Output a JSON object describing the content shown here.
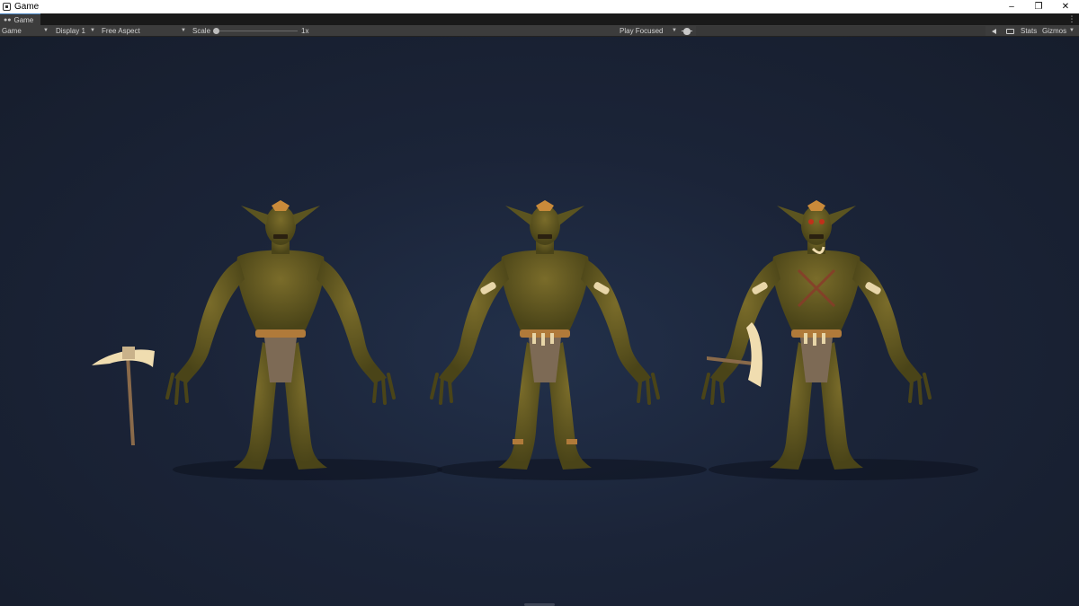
{
  "window": {
    "title": "Game",
    "controls": [
      "–",
      "❐",
      "✕"
    ]
  },
  "tab": {
    "label": "Game"
  },
  "toolbar": {
    "view_mode": "Game",
    "display": "Display 1",
    "aspect": "Free Aspect",
    "scale_label": "Scale",
    "scale_value": "1x",
    "scale_level": 0.0,
    "play_mode": "Play Focused",
    "stats": "Stats",
    "gizmos": "Gizmos"
  },
  "icons": {
    "tab": "eye-icon",
    "debug": "bug-icon",
    "audio": "speaker-icon",
    "shortcut": "keyboard-icon",
    "menu": "kebab-menu-icon"
  },
  "colors": {
    "viewport_bg": "#1b2435",
    "skin": "#5b5420",
    "skin_highlight": "#7a6c2a",
    "bone": "#e8d6a8",
    "rope": "#b07a3a",
    "cloth": "#7d6a55",
    "accent_tab": "#3a79bb"
  }
}
